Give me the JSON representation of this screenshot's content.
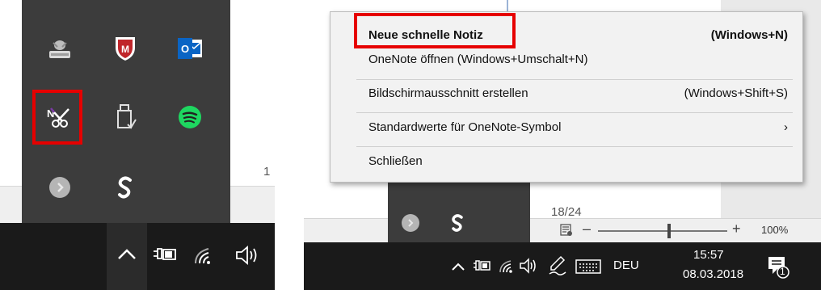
{
  "left_panel": {
    "doc_page_number": "1",
    "tray_icons": [
      "printer-icon",
      "mcafee-icon",
      "outlook-icon",
      "onenote-clipper-icon",
      "usb-drive-icon",
      "spotify-icon",
      "gray-circle-app-icon",
      "s-app-icon"
    ],
    "highlighted_icon": "onenote-clipper-icon",
    "taskbar_icons": [
      "chevron-up-icon",
      "power-icon",
      "wifi-icon",
      "volume-icon"
    ]
  },
  "context_menu": {
    "items": [
      {
        "label": "Neue schnelle Notiz",
        "shortcut": "(Windows+N)"
      },
      {
        "label": "OneNote öffnen (Windows+Umschalt+N)",
        "shortcut": ""
      },
      {
        "label": "Bildschirmausschnitt erstellen",
        "shortcut": "(Windows+Shift+S)"
      },
      {
        "label": "Standardwerte für OneNote-Symbol",
        "shortcut": "›"
      },
      {
        "label": "Schließen",
        "shortcut": ""
      }
    ],
    "highlighted_item": "Neue schnelle Notiz"
  },
  "right_panel": {
    "doc_text": "18/24",
    "zoom": {
      "minus": "–",
      "plus": "+",
      "percent": "100%",
      "level": 0.55
    },
    "taskbar": {
      "language": "DEU",
      "time": "15:57",
      "date": "08.03.2018",
      "notification_count": "1"
    }
  },
  "colors": {
    "highlight": "#e60000",
    "tray_bg": "#3c3c3c",
    "taskbar_bg": "#1a1a1a",
    "menu_bg": "#f2f2f2",
    "spotify": "#1ed760",
    "outlook": "#0a64c4",
    "onenote": "#7b3aa6",
    "mcafee": "#c0262b"
  }
}
